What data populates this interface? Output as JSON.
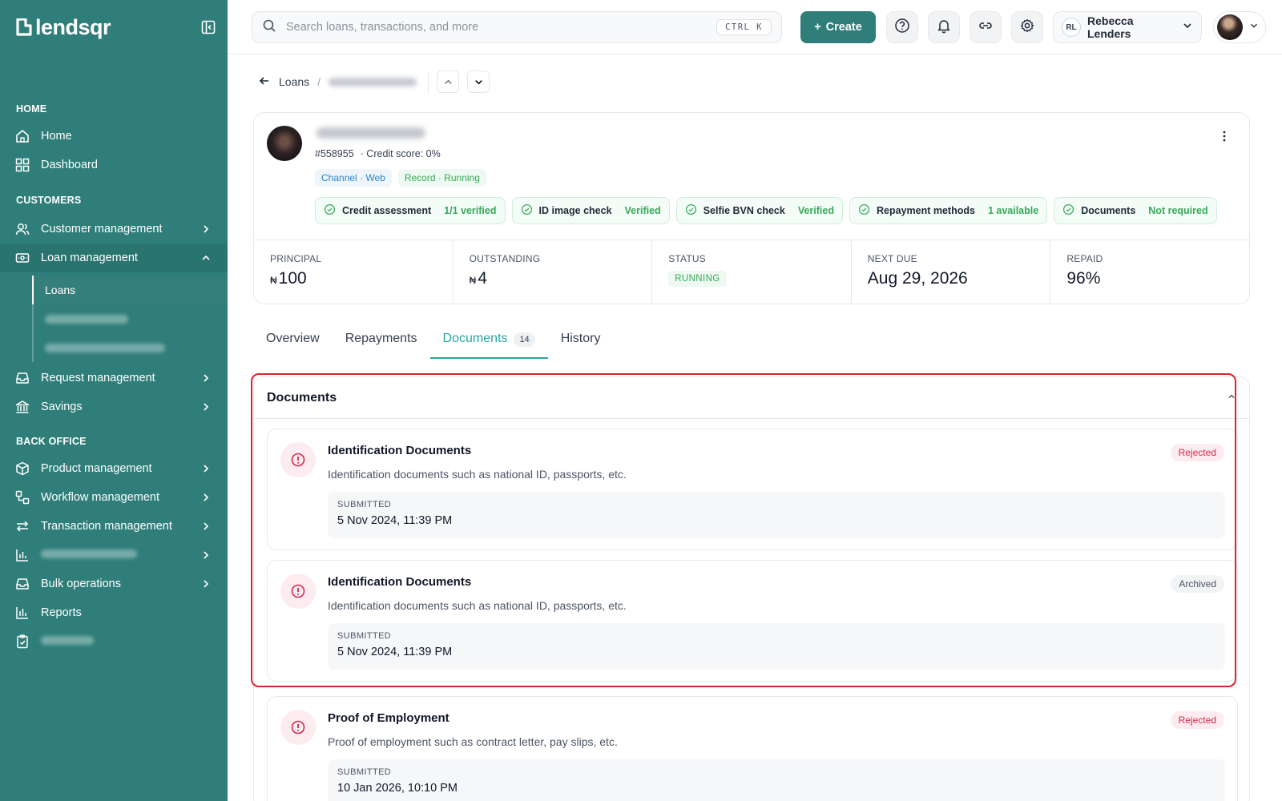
{
  "app": {
    "logo_text": "lendsqr"
  },
  "sidebar": {
    "sections": {
      "home": "HOME",
      "customers": "CUSTOMERS",
      "back_office": "BACK OFFICE"
    },
    "items": {
      "home": "Home",
      "dashboard": "Dashboard",
      "customer_management": "Customer management",
      "loan_management": "Loan management",
      "loans": "Loans",
      "request_management": "Request management",
      "savings": "Savings",
      "product_management": "Product management",
      "workflow_management": "Workflow management",
      "transaction_management": "Transaction management",
      "bulk_operations": "Bulk operations",
      "reports": "Reports"
    }
  },
  "topbar": {
    "search_placeholder": "Search loans, transactions, and more",
    "shortcut": "CTRL K",
    "create_label": "Create",
    "user_initials": "RL",
    "user_name": "Rebecca Lenders"
  },
  "breadcrumb": {
    "root": "Loans",
    "separator": "/"
  },
  "loan": {
    "id": "#558955",
    "credit_score": "· Credit score: 0%",
    "tags": [
      "Channel · Web",
      "Record · Running"
    ],
    "checks": [
      {
        "label": "Credit assessment",
        "status": "1/1 verified"
      },
      {
        "label": "ID image check",
        "status": "Verified"
      },
      {
        "label": "Selfie BVN check",
        "status": "Verified"
      },
      {
        "label": "Repayment methods",
        "status": "1 available"
      },
      {
        "label": "Documents",
        "status": "Not required"
      }
    ],
    "stats": {
      "principal_label": "PRINCIPAL",
      "principal_currency": "₦",
      "principal_value": "100",
      "outstanding_label": "OUTSTANDING",
      "outstanding_currency": "₦",
      "outstanding_value": "4",
      "status_label": "STATUS",
      "status_value": "RUNNING",
      "next_due_label": "NEXT DUE",
      "next_due_value": "Aug 29, 2026",
      "repaid_label": "REPAID",
      "repaid_value": "96%"
    }
  },
  "tabs": [
    {
      "label": "Overview"
    },
    {
      "label": "Repayments"
    },
    {
      "label": "Documents",
      "count": "14"
    },
    {
      "label": "History"
    }
  ],
  "documents": {
    "title": "Documents",
    "submitted_label": "SUBMITTED",
    "items": [
      {
        "title": "Identification Documents",
        "description": "Identification documents such as national ID, passports, etc.",
        "status": "Rejected",
        "submitted": "5 Nov 2024, 11:39 PM"
      },
      {
        "title": "Identification Documents",
        "description": "Identification documents such as national ID, passports, etc.",
        "status": "Archived",
        "submitted": "5 Nov 2024, 11:39 PM"
      },
      {
        "title": "Proof of Employment",
        "description": "Proof of employment such as contract letter, pay slips, etc.",
        "status": "Rejected",
        "submitted": "10 Jan 2026, 10:10 PM"
      }
    ]
  },
  "colors": {
    "brand": "#2f7e7a",
    "accent_tab": "#2aa6a1",
    "success": "#38a85a",
    "danger": "#d7264e",
    "highlight": "#d9232e"
  }
}
